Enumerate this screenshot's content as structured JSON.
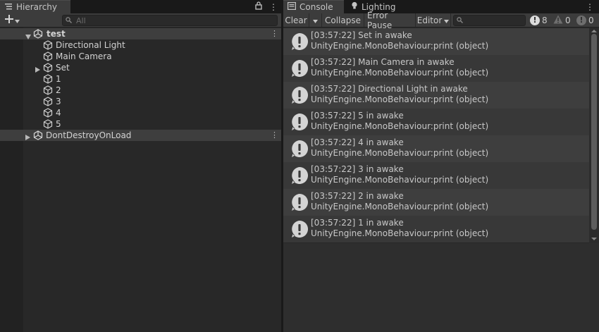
{
  "hierarchy": {
    "tab_label": "Hierarchy",
    "search_placeholder": "All",
    "scene_name": "test",
    "items": [
      "Directional Light",
      "Main Camera",
      "Set",
      "1",
      "2",
      "3",
      "4",
      "5"
    ],
    "ddol_label": "DontDestroyOnLoad"
  },
  "console": {
    "tabs": [
      "Console",
      "Lighting"
    ],
    "toolbar": {
      "clear": "Clear",
      "collapse": "Collapse",
      "error_pause": "Error Pause",
      "editor": "Editor"
    },
    "counts": {
      "info": "8",
      "warning": "0",
      "error": "0"
    },
    "entries": [
      {
        "line1": "[03:57:22] Set in awake",
        "line2": "UnityEngine.MonoBehaviour:print (object)"
      },
      {
        "line1": "[03:57:22] Main Camera in awake",
        "line2": "UnityEngine.MonoBehaviour:print (object)"
      },
      {
        "line1": "[03:57:22] Directional Light in awake",
        "line2": "UnityEngine.MonoBehaviour:print (object)"
      },
      {
        "line1": "[03:57:22] 5 in awake",
        "line2": "UnityEngine.MonoBehaviour:print (object)"
      },
      {
        "line1": "[03:57:22] 4 in awake",
        "line2": "UnityEngine.MonoBehaviour:print (object)"
      },
      {
        "line1": "[03:57:22] 3 in awake",
        "line2": "UnityEngine.MonoBehaviour:print (object)"
      },
      {
        "line1": "[03:57:22] 2 in awake",
        "line2": "UnityEngine.MonoBehaviour:print (object)"
      },
      {
        "line1": "[03:57:22] 1 in awake",
        "line2": "UnityEngine.MonoBehaviour:print (object)"
      }
    ]
  },
  "colors": {
    "panel_bg": "#282828",
    "toolbar_bg": "#3c3c3c",
    "row_even": "#3e3e3e",
    "row_odd": "#383838",
    "text": "#d2d2d2"
  }
}
